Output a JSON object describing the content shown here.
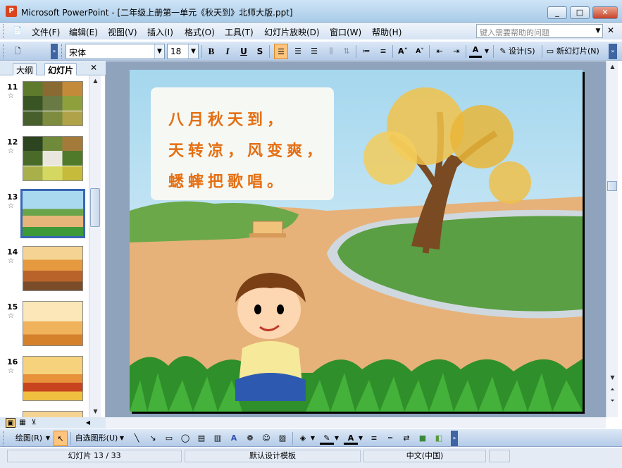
{
  "window": {
    "title": "Microsoft PowerPoint - [二年级上册第一单元《秋天到》北师大版.ppt]",
    "app_icon": "powerpoint-icon"
  },
  "menu": [
    "文件(F)",
    "编辑(E)",
    "视图(V)",
    "插入(I)",
    "格式(O)",
    "工具(T)",
    "幻灯片放映(D)",
    "窗口(W)",
    "帮助(H)"
  ],
  "help": {
    "placeholder": "键入需要帮助的问题"
  },
  "toolbar": {
    "font": "宋体",
    "size": "18",
    "bold": "B",
    "italic": "I",
    "underline": "U",
    "shadow": "S",
    "design_label": "设计(S)",
    "new_slide_label": "新幻灯片(N)"
  },
  "left_pane": {
    "tabs": [
      "大纲",
      "幻灯片"
    ],
    "slides": [
      {
        "num": "11",
        "star": "☆"
      },
      {
        "num": "12",
        "star": "☆"
      },
      {
        "num": "13",
        "star": "☆"
      },
      {
        "num": "14",
        "star": "☆"
      },
      {
        "num": "15",
        "star": "☆"
      },
      {
        "num": "16",
        "star": "☆"
      }
    ],
    "selected": "13"
  },
  "slide": {
    "lines": [
      "八月秋天到，",
      "天转凉，风变爽，",
      "蟋蟀把歌唱。"
    ]
  },
  "drawing_toolbar": {
    "draw_label": "绘图(R)",
    "autoshape_label": "自选图形(U)"
  },
  "status": {
    "slide_position": "幻灯片 13 / 33",
    "template": "默认设计模板",
    "language": "中文(中国)"
  },
  "colors": {
    "accent": "#e46f13",
    "selection": "#3a66b3",
    "slide_background": "#8fa3bd"
  }
}
